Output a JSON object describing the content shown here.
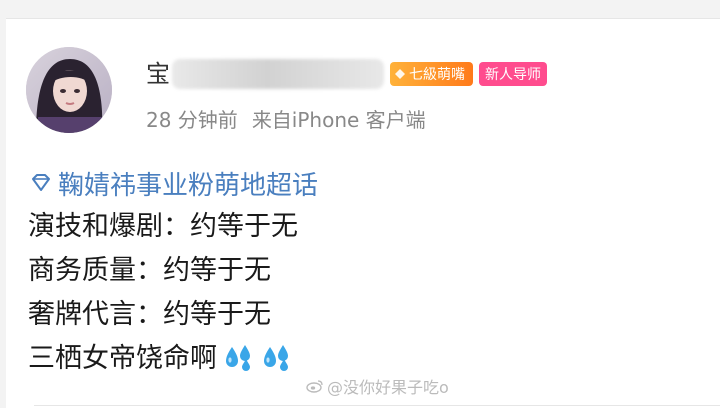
{
  "post": {
    "author": {
      "name_visible_char": "宝",
      "level_badge": "七級萌嘴",
      "mentor_badge": "新人导师"
    },
    "time": "28 分钟前",
    "source": "来自iPhone 客户端",
    "topic": "鞠婧祎事业粉萌地超话",
    "lines": [
      "演技和爆剧：约等于无",
      "商务质量：约等于无",
      "奢牌代言：约等于无",
      "三栖女帝饶命啊"
    ],
    "emoji_icons": [
      "sweat-drops-icon",
      "sweat-drops-icon"
    ]
  },
  "watermark": "@没你好果子吃o",
  "colors": {
    "topic": "#4a7fbf",
    "level_badge": "#ff8a1f",
    "mentor_badge": "#ff4c8e",
    "meta": "#888888"
  }
}
